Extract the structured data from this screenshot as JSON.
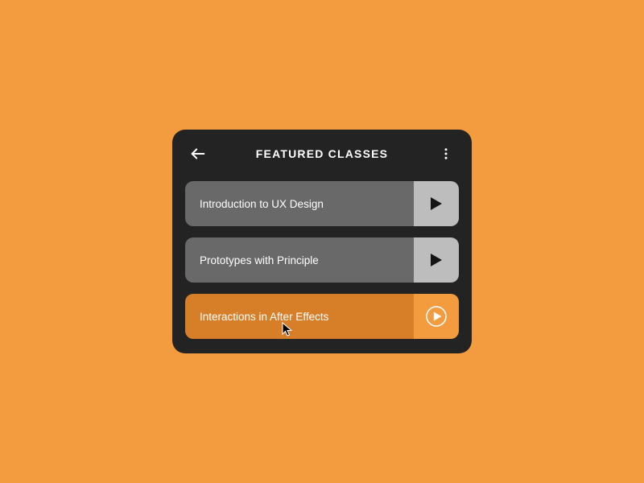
{
  "header": {
    "title": "FEATURED CLASSES"
  },
  "classes": [
    {
      "title": "Introduction to UX Design",
      "active": false
    },
    {
      "title": "Prototypes with Principle",
      "active": false
    },
    {
      "title": "Interactions in After Effects",
      "active": true
    }
  ],
  "colors": {
    "background": "#f29b3f",
    "card": "#232323",
    "item_bg": "#696969",
    "item_play_bg": "#bdbdbd",
    "active_bg": "#d67f28",
    "active_play_bg": "#f29b3f"
  }
}
